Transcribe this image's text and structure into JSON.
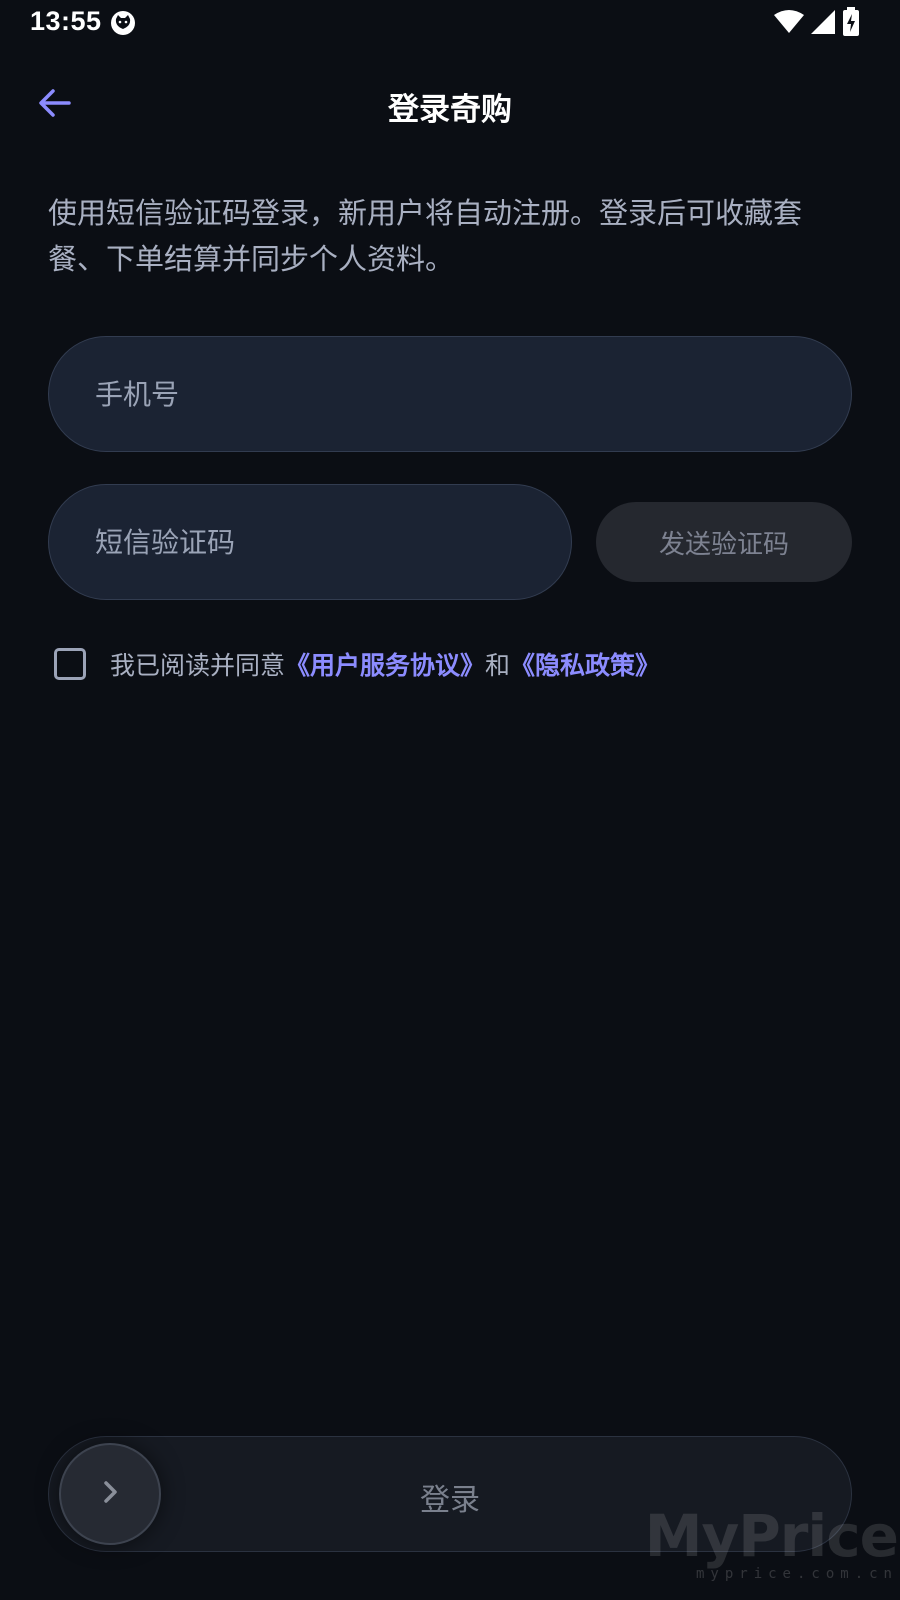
{
  "status_bar": {
    "time": "13:55"
  },
  "header": {
    "title": "登录奇购"
  },
  "description": "使用短信验证码登录，新用户将自动注册。登录后可收藏套餐、下单结算并同步个人资料。",
  "form": {
    "phone_placeholder": "手机号",
    "code_placeholder": "短信验证码",
    "send_code_label": "发送验证码"
  },
  "agreement": {
    "prefix": "我已阅读并同意",
    "terms_link": "《用户服务协议》",
    "conjunction": "和",
    "privacy_link": "《隐私政策》",
    "checked": false
  },
  "login": {
    "label": "登录"
  },
  "watermark": {
    "logo": "MyPrice",
    "domain": "myprice.com.cn"
  },
  "colors": {
    "background": "#0b0e14",
    "accent": "#8c8cff",
    "input_bg": "#1b2333"
  },
  "icons": {
    "back": "arrow-left-icon",
    "wifi": "wifi-icon",
    "signal": "signal-icon",
    "battery": "battery-charging-icon",
    "notification": "cat-face-icon",
    "slider": "chevron-right-icon"
  }
}
